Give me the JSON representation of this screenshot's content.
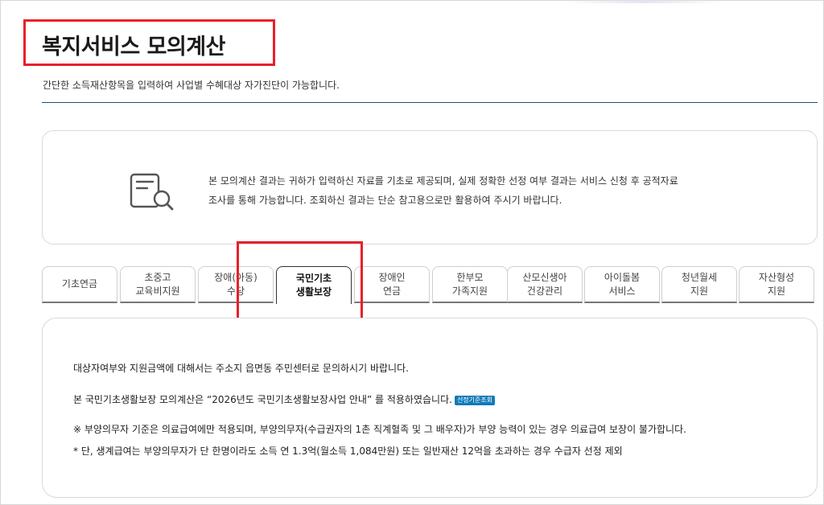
{
  "page": {
    "title": "복지서비스 모의계산",
    "subtitle": "간단한 소득재산항목을 입력하여 사업별 수혜대상 자가진단이 가능합니다."
  },
  "notice": {
    "icon": "document-search-icon",
    "line1": "본 모의계산 결과는 귀하가 입력하신 자료를 기초로 제공되며, 실제 정확한 선정 여부 결과는 서비스 신청 후 공적자료",
    "line2": "조사를 통해 가능합니다. 조회하신 결과는 단순 참고용으로만 활용하여 주시기 바랍니다."
  },
  "tabs": [
    {
      "l1": "기초연금",
      "l2": ""
    },
    {
      "l1": "초중고",
      "l2": "교육비지원"
    },
    {
      "l1": "장애(아동)",
      "l2": "수당"
    },
    {
      "l1": "국민기초",
      "l2": "생활보장",
      "active": true
    },
    {
      "l1": "장애인",
      "l2": "연금"
    },
    {
      "l1": "한부모",
      "l2": "가족지원"
    },
    {
      "l1": "산모신생아",
      "l2": "건강관리"
    },
    {
      "l1": "아이돌봄",
      "l2": "서비스"
    },
    {
      "l1": "청년월세",
      "l2": "지원"
    },
    {
      "l1": "자산형성",
      "l2": "지원"
    }
  ],
  "content": {
    "line1": "대상자여부와 지원금액에 대해서는 주소지 읍면동 주민센터로 문의하시기 바랍니다.",
    "line2": "본 국민기초생활보장 모의계산은 “2026년도 국민기초생활보장사업 안내” 를 적용하였습니다.",
    "badge": "선정기준조회",
    "line3": "※ 부양의무자 기준은 의료급여에만 적용되며, 부양의무자(수급권자의 1촌 직계혈족 및 그 배우자)가 부양 능력이 있는 경우 의료급여 보장이 불가합니다.",
    "line4": "* 단, 생계급여는 부양의무자가 단 한명이라도 소득 연 1.3억(월소득 1,084만원) 또는 일반재산 12억을 초과하는 경우 수급자 선정 제외"
  },
  "colors": {
    "highlight": "#e8202a",
    "badge": "#0f7ab8",
    "rule": "#1d4e7e"
  }
}
